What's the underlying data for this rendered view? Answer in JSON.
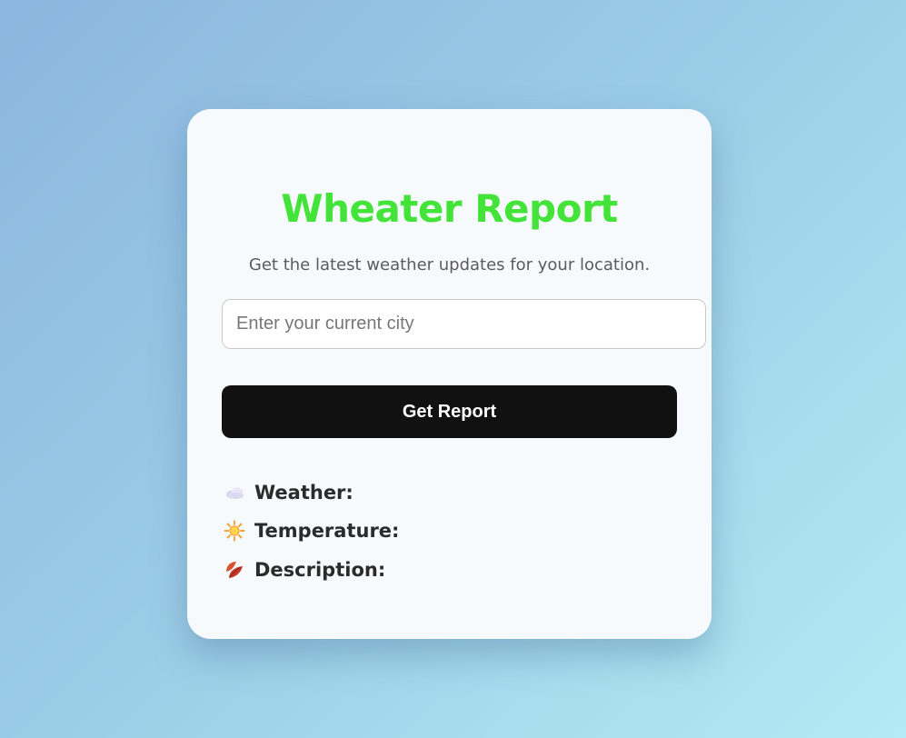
{
  "app": {
    "title": "Wheater Report",
    "subtitle": "Get the latest weather updates for your location."
  },
  "search": {
    "placeholder": "Enter your current city",
    "value": ""
  },
  "actions": {
    "get_report_label": "Get Report"
  },
  "results": [
    {
      "icon": "cloud-icon",
      "label": "Weather:",
      "value": ""
    },
    {
      "icon": "sun-icon",
      "label": "Temperature:",
      "value": ""
    },
    {
      "icon": "leaf-icon",
      "label": "Description:",
      "value": ""
    }
  ],
  "colors": {
    "title": "#43e33a",
    "button_bg": "#111111",
    "card_bg": "#f7fafd"
  }
}
